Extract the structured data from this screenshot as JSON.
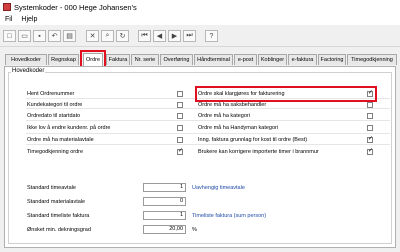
{
  "window": {
    "title": "Systemkoder - 000 Hege Johansen's"
  },
  "menu": [
    "Fil",
    "Hjelp"
  ],
  "toolbar": {
    "icons": [
      "new-icon",
      "open-icon",
      "save-icon",
      "undo-icon",
      "print-icon",
      "delete-icon",
      "find-icon",
      "refresh-icon",
      "nav-first-icon",
      "nav-prev-icon",
      "nav-next-icon",
      "nav-last-icon",
      "help-icon"
    ]
  },
  "tabs": [
    "Hovedkoder",
    "Regnskap",
    "Ordre",
    "Faktura",
    "Nr. serie",
    "Overføring",
    "Håndterminal",
    "e-post",
    "Koblinger",
    "e-faktura",
    "Factoring",
    "Timegodkjenning"
  ],
  "active_tab": 2,
  "group_label": "Hovedkoder",
  "left_options": [
    {
      "label": "Hent Ordrenummer",
      "checked": false
    },
    {
      "label": "Kundekategori til ordre",
      "checked": false
    },
    {
      "label": "Ordredato til startdato",
      "checked": false
    },
    {
      "label": "Ikke lov å endre kundenr. på ordre",
      "checked": false
    },
    {
      "label": "Ordre må ha materialavtale",
      "checked": false
    },
    {
      "label": "Timegodkjenning ordre",
      "checked": true
    }
  ],
  "right_options": [
    {
      "label": "Ordre skal klargjøres for fakturering",
      "checked": true
    },
    {
      "label": "Ordre må ha saksbehandler",
      "checked": false
    },
    {
      "label": "Ordre må ha kategori",
      "checked": false
    },
    {
      "label": "Ordre må ha Handyman kategori",
      "checked": false
    },
    {
      "label": "Inng. faktura grunnlag for kost til ordre (Best)",
      "checked": true
    },
    {
      "label": "Brukere kan korrigere importerte timer i brannmur",
      "checked": true
    }
  ],
  "fields": [
    {
      "label": "Standard timeavtale",
      "value": "1",
      "link": "Uavhengig timeavtale"
    },
    {
      "label": "Standard materialavtale",
      "value": "0",
      "link": ""
    },
    {
      "label": "Standard timeliste faktura",
      "value": "1",
      "link": "Timeliste faktura (sum person)"
    },
    {
      "label": "Ønsket min. dekningsgrad",
      "value": "20,00",
      "link": "%"
    }
  ]
}
